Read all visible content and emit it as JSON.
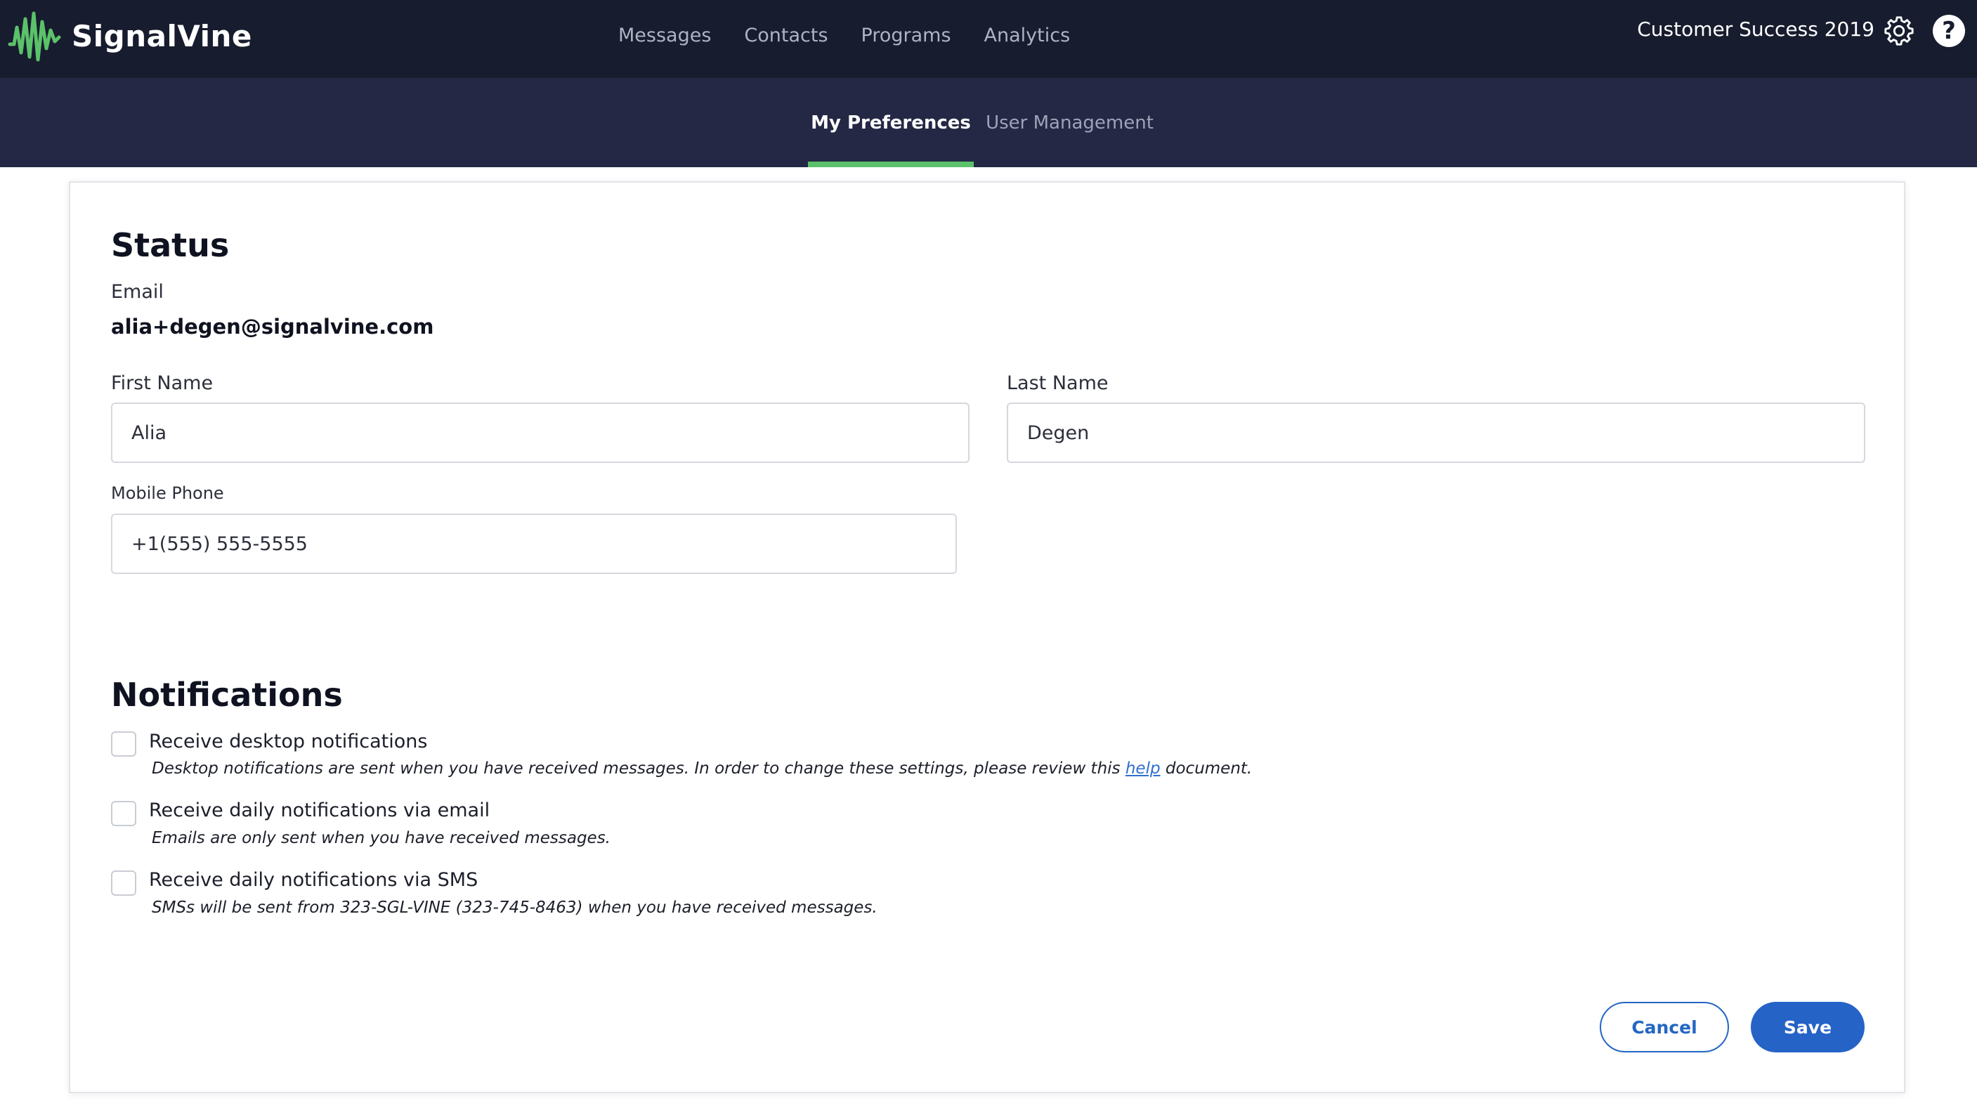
{
  "header": {
    "brand": "SignalVine",
    "brand_color": "#5bc16a",
    "nav": [
      "Messages",
      "Contacts",
      "Programs",
      "Analytics"
    ],
    "org_name": "Customer Success 2019",
    "settings_icon": "gear-icon",
    "help_icon": "help-icon",
    "help_glyph": "?"
  },
  "subnav": {
    "tabs": [
      {
        "label": "My Preferences",
        "active": true
      },
      {
        "label": "User Management",
        "active": false
      }
    ],
    "active_color": "#5bc16a"
  },
  "status": {
    "title": "Status",
    "email_label": "Email",
    "email_value": "alia+degen@signalvine.com",
    "first_name_label": "First Name",
    "first_name_value": "Alia",
    "last_name_label": "Last Name",
    "last_name_value": "Degen",
    "mobile_label": "Mobile Phone",
    "mobile_value": "+1(555) 555-5555"
  },
  "notifications": {
    "title": "Notifications",
    "items": [
      {
        "label": "Receive desktop notifications",
        "desc_before": "Desktop notifications are sent when you have received messages. In order to change these settings, please review this ",
        "desc_link": "help",
        "desc_after": " document.",
        "checked": false
      },
      {
        "label": "Receive daily notifications via email",
        "desc": "Emails are only sent when you have received messages.",
        "checked": false
      },
      {
        "label": "Receive daily notifications via SMS",
        "desc": "SMSs will be sent from 323-SGL-VINE (323-745-8463) when you have received messages.",
        "checked": false
      }
    ]
  },
  "actions": {
    "cancel_label": "Cancel",
    "save_label": "Save",
    "primary_color": "#2563c7"
  }
}
